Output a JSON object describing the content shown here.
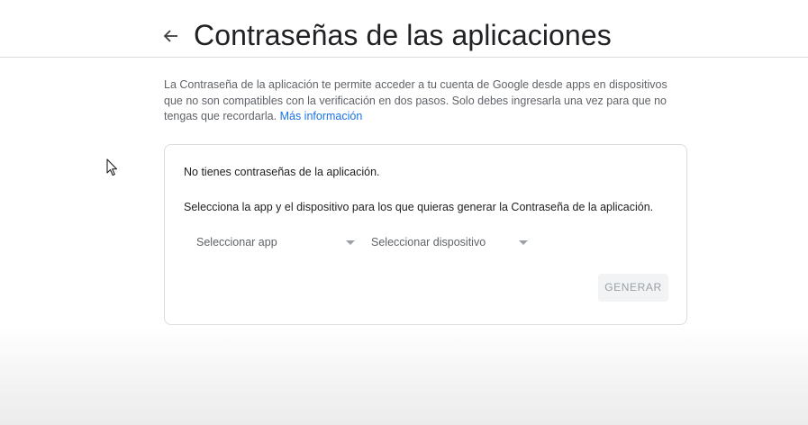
{
  "header": {
    "title": "Contraseñas de las aplicaciones",
    "back_icon": "arrow-back-icon"
  },
  "description": {
    "text": "La Contraseña de la aplicación te permite acceder a tu cuenta de Google desde apps en dispositivos que no son compatibles con la verificación en dos pasos. Solo debes ingresarla una vez para que no tengas que recordarla.",
    "link_label": "Más información"
  },
  "card": {
    "empty_message": "No tienes contraseñas de la aplicación.",
    "instructions": "Selecciona la app y el dispositivo para los que quieras generar la Contraseña de la aplicación.",
    "app_select": {
      "label": "Seleccionar app",
      "icon": "dropdown-arrow-icon"
    },
    "device_select": {
      "label": "Seleccionar dispositivo",
      "icon": "dropdown-arrow-icon"
    },
    "generate_button": {
      "label": "GENERAR",
      "disabled": true
    }
  },
  "colors": {
    "link": "#1a73e8",
    "text_primary": "#202124",
    "text_secondary": "#5f6368",
    "disabled_button_bg": "#f1f3f4",
    "disabled_button_text": "#9aa0a6",
    "border": "#dadce0"
  },
  "cursor_icon": "mouse-pointer-icon"
}
